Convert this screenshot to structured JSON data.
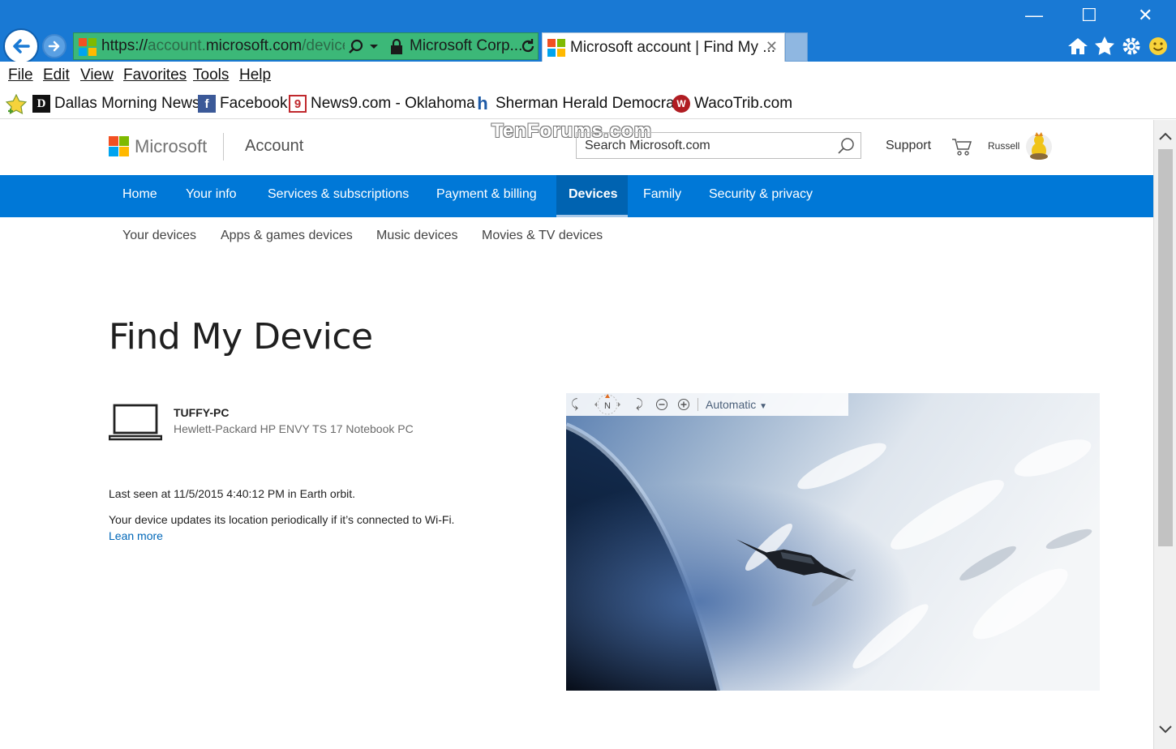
{
  "browser": {
    "address": {
      "url_prefix": "https://",
      "url_host_dim": "account.",
      "url_host": "microsoft.com",
      "url_path": "/device",
      "cert_label": "Microsoft Corp..."
    },
    "tab": {
      "title": "Microsoft account | Find My ..."
    },
    "menu": [
      "File",
      "Edit",
      "View",
      "Favorites",
      "Tools",
      "Help"
    ],
    "favorites": [
      {
        "label": "Dallas Morning News",
        "icon": "dallas-news-icon",
        "glyph": "D"
      },
      {
        "label": "Facebook",
        "icon": "facebook-icon",
        "glyph": "f"
      },
      {
        "label": "News9.com - Oklahoma",
        "icon": "news9-icon",
        "glyph": "9"
      },
      {
        "label": "Sherman Herald Democrat",
        "icon": "herald-icon",
        "glyph": "h"
      },
      {
        "label": "WacoTrib.com",
        "icon": "wacotrib-icon",
        "glyph": "W"
      }
    ]
  },
  "site": {
    "brand": "Microsoft",
    "section": "Account",
    "watermark": "TenForums.com",
    "search": {
      "placeholder": "Search Microsoft.com"
    },
    "support": "Support",
    "user": "Russell",
    "nav": [
      "Home",
      "Your info",
      "Services & subscriptions",
      "Payment & billing",
      "Devices",
      "Family",
      "Security & privacy"
    ],
    "active_nav": "Devices",
    "subnav": [
      "Your devices",
      "Apps & games devices",
      "Music devices",
      "Movies & TV devices"
    ]
  },
  "page": {
    "title": "Find My Device",
    "device": {
      "name": "TUFFY-PC",
      "model": "Hewlett-Packard HP ENVY TS 17 Notebook PC"
    },
    "last_seen": "Last seen at 11/5/2015 4:40:12 PM in Earth orbit.",
    "update_info": "Your device updates its location periodically if it’s connected to Wi-Fi.",
    "learn_more": "Lean more",
    "map": {
      "mode": "Automatic",
      "compass": "N"
    }
  },
  "colors": {
    "chrome": "#1979d4",
    "nav": "#0078d7",
    "link": "#0067b8",
    "address": "#3cb878"
  }
}
